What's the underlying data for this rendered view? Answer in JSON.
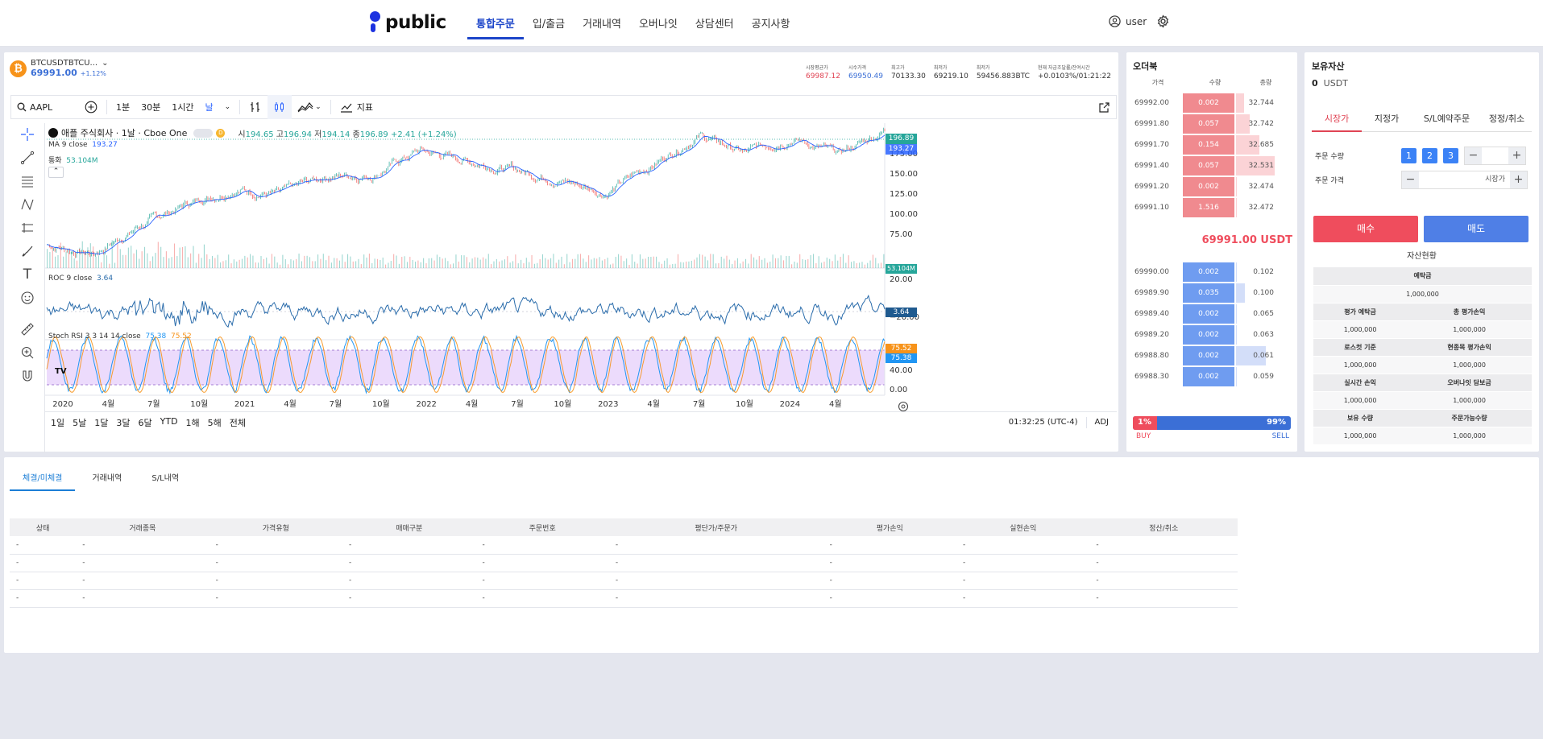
{
  "nav": {
    "logo": "public",
    "links": [
      "통합주문",
      "입/출금",
      "거래내역",
      "오버나잇",
      "상담센터",
      "공지사항"
    ],
    "active": 0,
    "user": "user"
  },
  "ticker": {
    "symbol": "BTCUSDTBTCU...",
    "price": "69991.00",
    "change": "+1.12%",
    "stats": [
      {
        "label": "시장평균가",
        "value": "69987.12",
        "color": "#e04454"
      },
      {
        "label": "시수가격",
        "value": "69950.49",
        "color": "#3b6fd6"
      },
      {
        "label": "최고가",
        "value": "70133.30",
        "color": "#333333"
      },
      {
        "label": "최저가",
        "value": "69219.10",
        "color": "#333333"
      },
      {
        "label": "최저가",
        "value": "59456.883BTC",
        "color": "#333333"
      },
      {
        "label": "현재 자금조달률/잔여시간",
        "value": "+0.0103%/01:21:22",
        "color": "#333333"
      }
    ]
  },
  "toolbar": {
    "search": "AAPL",
    "intervals": [
      "1분",
      "30분",
      "1시간",
      "날"
    ],
    "indicators": "지표"
  },
  "chart": {
    "legend_title": "애플 주식회사 · 1날 · Cboe One",
    "ohlc": {
      "o_label": "시",
      "o": "194.65",
      "h_label": "고",
      "h": "196.94",
      "l_label": "저",
      "l": "194.14",
      "c_label": "종",
      "c": "196.89",
      "chg": "+2.41 (+1.24%)"
    },
    "ma_label": "MA 9 close",
    "ma_value": "193.27",
    "vol_label": "통화",
    "vol_value": "53.104M",
    "roc_label": "ROC 9 close",
    "roc_value": "3.64",
    "stoch_label": "Stoch RSI 3 3 14 14 close",
    "stoch_k": "75.38",
    "stoch_d": "75.52",
    "price_badges": [
      "196.89",
      "193.27"
    ],
    "vol_badge": "53.104M",
    "roc_badge": "3.64",
    "stoch_badges": [
      "75.52",
      "75.38"
    ],
    "y_ticks": [
      "175.00",
      "150.00",
      "125.00",
      "100.00",
      "75.00"
    ],
    "roc_ticks": [
      "20.00",
      "−20.00"
    ],
    "stoch_ticks": [
      "80.00",
      "40.00",
      "0.00"
    ],
    "x_ticks": [
      "2020",
      "4월",
      "7월",
      "10월",
      "2021",
      "4월",
      "7월",
      "10월",
      "2022",
      "4월",
      "7월",
      "10월",
      "2023",
      "4월",
      "7월",
      "10월",
      "2024",
      "4월"
    ],
    "ranges": [
      "1일",
      "5날",
      "1달",
      "3달",
      "6달",
      "YTD",
      "1해",
      "5해",
      "전체"
    ],
    "clock": "01:32:25 (UTC-4)",
    "adj": "ADJ",
    "logo": "TV"
  },
  "chart_data": {
    "type": "line",
    "title": "애플 주식회사 · 1날 · Cboe One",
    "x": [
      "2020-01",
      "2020-04",
      "2020-07",
      "2020-10",
      "2021-01",
      "2021-04",
      "2021-07",
      "2021-10",
      "2022-01",
      "2022-04",
      "2022-07",
      "2022-10",
      "2023-01",
      "2023-04",
      "2023-07",
      "2023-10",
      "2024-01",
      "2024-04",
      "2024-06"
    ],
    "series": [
      {
        "name": "",
        "values": [
          75,
          65,
          95,
          118,
          135,
          128,
          148,
          150,
          175,
          165,
          155,
          145,
          130,
          160,
          192,
          172,
          190,
          170,
          196.89
        ]
      },
      {
        "name": "MA 9 close",
        "values": [
          74,
          68,
          92,
          116,
          132,
          130,
          145,
          149,
          172,
          166,
          156,
          146,
          132,
          158,
          189,
          174,
          188,
          172,
          193.27
        ]
      }
    ],
    "xlabel": "",
    "ylabel": "",
    "ylim": [
      50,
      200
    ],
    "grid": false,
    "legend": "top-left"
  },
  "orderbook": {
    "title": "오더북",
    "headers": [
      "가격",
      "수량",
      "총량"
    ],
    "asks": [
      {
        "price": "69992.00",
        "qty": "0.002",
        "total": "32.744",
        "depth": 0.18
      },
      {
        "price": "69991.80",
        "qty": "0.057",
        "total": "32.742",
        "depth": 0.33
      },
      {
        "price": "69991.70",
        "qty": "0.154",
        "total": "32.685",
        "depth": 0.55
      },
      {
        "price": "69991.40",
        "qty": "0.057",
        "total": "32.531",
        "depth": 0.9
      },
      {
        "price": "69991.20",
        "qty": "0.002",
        "total": "32.474",
        "depth": 0.02
      },
      {
        "price": "69991.10",
        "qty": "1.516",
        "total": "32.472",
        "depth": 0.01
      }
    ],
    "last": "69991.00 USDT",
    "bids": [
      {
        "price": "69990.00",
        "qty": "0.002",
        "total": "0.102",
        "depth": 0.01
      },
      {
        "price": "69989.90",
        "qty": "0.035",
        "total": "0.100",
        "depth": 0.2
      },
      {
        "price": "69989.40",
        "qty": "0.002",
        "total": "0.065",
        "depth": 0.01
      },
      {
        "price": "69989.20",
        "qty": "0.002",
        "total": "0.063",
        "depth": 0.01
      },
      {
        "price": "69988.80",
        "qty": "0.002",
        "total": "0.061",
        "depth": 0.7
      },
      {
        "price": "69988.30",
        "qty": "0.002",
        "total": "0.059",
        "depth": 0.01
      }
    ],
    "buy_pct": "1%",
    "sell_pct": "99%",
    "buy_ratio": 0.01,
    "buy_label": "BUY",
    "sell_label": "SELL"
  },
  "assets": {
    "title": "보유자산",
    "balance": "0",
    "currency": "USDT",
    "tabs": [
      "시장가",
      "지정가",
      "S/L예약주문",
      "정정/취소"
    ],
    "qty_label": "주문 수량",
    "qty_buttons": [
      "1",
      "2",
      "3"
    ],
    "price_label": "주문 가격",
    "price_value": "시장가",
    "buy": "매수",
    "sell": "매도",
    "summary_title": "자산현황",
    "rows": [
      [
        {
          "h": "예탁금",
          "v": "1,000,000"
        }
      ],
      [
        {
          "h": "평가 예탁금",
          "v": "1,000,000"
        },
        {
          "h": "총 평가손익",
          "v": "1,000,000"
        }
      ],
      [
        {
          "h": "로스컷 기준",
          "v": "1,000,000"
        },
        {
          "h": "현종목 평가손익",
          "v": "1,000,000"
        }
      ],
      [
        {
          "h": "실시간 손익",
          "v": "1,000,000"
        },
        {
          "h": "오버나잇 담보금",
          "v": "1,000,000"
        }
      ],
      [
        {
          "h": "보유 수량",
          "v": "1,000,000"
        },
        {
          "h": "주문가능수량",
          "v": "1,000,000"
        }
      ]
    ]
  },
  "bottom": {
    "tabs": [
      "체결/미체결",
      "거래내역",
      "S/L내역"
    ],
    "columns": [
      "상태",
      "거래종목",
      "가격유형",
      "매매구분",
      "주문번호",
      "평단가/주문가",
      "평가손익",
      "실현손익",
      "정산/취소"
    ],
    "rows": [
      [
        "-",
        "-",
        "-",
        "-",
        "-",
        "-",
        "-",
        "-",
        "-"
      ],
      [
        "-",
        "-",
        "-",
        "-",
        "-",
        "-",
        "-",
        "-",
        "-"
      ],
      [
        "-",
        "-",
        "-",
        "-",
        "-",
        "-",
        "-",
        "-",
        "-"
      ],
      [
        "-",
        "-",
        "-",
        "-",
        "-",
        "-",
        "-",
        "-",
        "-"
      ]
    ]
  },
  "colors": {
    "ask": "#f08a8f",
    "bid": "#6f9cf0",
    "buy": "#ef4d5d",
    "sell": "#4f7fe6",
    "accent": "#1c45c9"
  }
}
